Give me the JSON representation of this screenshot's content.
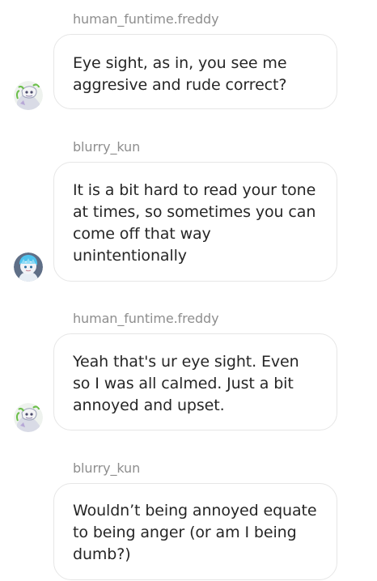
{
  "messages": [
    {
      "sender": "human_funtime.freddy",
      "text": "Eye sight, as in, you see me aggresive and rude correct?",
      "avatar_icon": "dragon-avatar-icon"
    },
    {
      "sender": "blurry_kun",
      "text": "It is a bit hard to read your tone at times, so sometimes you can come off that way unintentionally",
      "avatar_icon": "blue-haired-character-avatar-icon"
    },
    {
      "sender": "human_funtime.freddy",
      "text": "Yeah that's ur eye sight. Even so I was all calmed. Just a bit annoyed and upset.",
      "avatar_icon": "dragon-avatar-icon"
    },
    {
      "sender": "blurry_kun",
      "text": "Wouldn’t being annoyed equate to being anger (or am I being dumb?)"
    }
  ],
  "colors": {
    "sender_name": "#8e8e8e",
    "bubble_border": "#e6e6e6",
    "message_text": "#262626",
    "background": "#ffffff"
  }
}
